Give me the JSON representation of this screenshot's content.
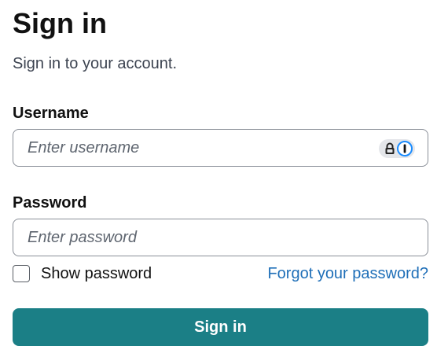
{
  "header": {
    "title": "Sign in",
    "subtitle": "Sign in to your account."
  },
  "username": {
    "label": "Username",
    "value": "",
    "placeholder": "Enter username",
    "password_manager_icons": [
      "lock-icon",
      "onepassword-icon"
    ]
  },
  "password": {
    "label": "Password",
    "value": "",
    "placeholder": "Enter password"
  },
  "show_password": {
    "label": "Show password",
    "checked": false
  },
  "forgot_password": {
    "label": "Forgot your password?"
  },
  "submit": {
    "label": "Sign in"
  },
  "colors": {
    "primary_button": "#1b7f86",
    "link": "#1f6fb8",
    "onepassword_blue": "#1a8cff"
  }
}
